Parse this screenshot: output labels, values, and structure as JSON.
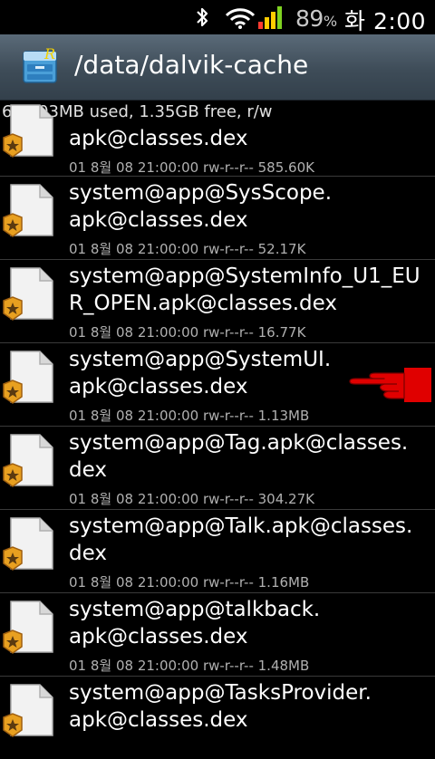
{
  "status_bar": {
    "battery_percent": "89",
    "percent_sign": "%",
    "clock": "화 2:00",
    "icons": [
      "bluetooth-icon",
      "wifi-icon",
      "signal-icon"
    ],
    "icon_colors": {
      "bluetooth": "#ffffff",
      "wifi": "#ffffff",
      "signal": [
        "#ff3b30",
        "#ffcc00",
        "#ffcc00",
        "#7fd321"
      ]
    }
  },
  "title_bar": {
    "path": "/data/dalvik-cache",
    "app_icon": "file-manager-icon"
  },
  "storage_info": "636.03MB used, 1.35GB free, r/w",
  "files": [
    {
      "name_lines": [
        "apk@classes.dex"
      ],
      "meta": "01 8월 08 21:00:00  rw-r--r--   585.60K"
    },
    {
      "name_lines": [
        "system@app@SysScope.",
        "apk@classes.dex"
      ],
      "meta": "01 8월 08 21:00:00  rw-r--r--   52.17K"
    },
    {
      "name_lines": [
        "system@app@SystemInfo_U1_EU",
        "R_OPEN.apk@classes.dex"
      ],
      "meta": "01 8월 08 21:00:00  rw-r--r--   16.77K"
    },
    {
      "name_lines": [
        "system@app@SystemUI.",
        "apk@classes.dex"
      ],
      "meta": "01 8월 08 21:00:00  rw-r--r--   1.13MB"
    },
    {
      "name_lines": [
        "system@app@Tag.apk@classes.",
        "dex"
      ],
      "meta": "01 8월 08 21:00:00  rw-r--r--   304.27K"
    },
    {
      "name_lines": [
        "system@app@Talk.apk@classes.",
        "dex"
      ],
      "meta": "01 8월 08 21:00:00  rw-r--r--   1.16MB"
    },
    {
      "name_lines": [
        "system@app@talkback.",
        "apk@classes.dex"
      ],
      "meta": "01 8월 08 21:00:00  rw-r--r--   1.48MB"
    },
    {
      "name_lines": [
        "system@app@TasksProvider.",
        "apk@classes.dex"
      ],
      "meta": ""
    }
  ],
  "overlay": {
    "pointer_icon": "pointing-hand-icon",
    "pointer_color": "#e00000"
  }
}
